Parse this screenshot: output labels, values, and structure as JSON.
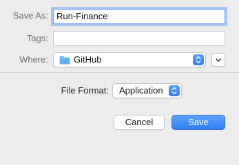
{
  "save_as": {
    "label": "Save As:",
    "value": "Run-Finance"
  },
  "tags": {
    "label": "Tags:",
    "value": ""
  },
  "where": {
    "label": "Where:",
    "value": "GitHub",
    "folder_color": "#5fb0f0"
  },
  "file_format": {
    "label": "File Format:",
    "value": "Application"
  },
  "buttons": {
    "cancel": "Cancel",
    "save": "Save"
  },
  "colors": {
    "accent": "#2f7df6",
    "background": "#ececec"
  }
}
